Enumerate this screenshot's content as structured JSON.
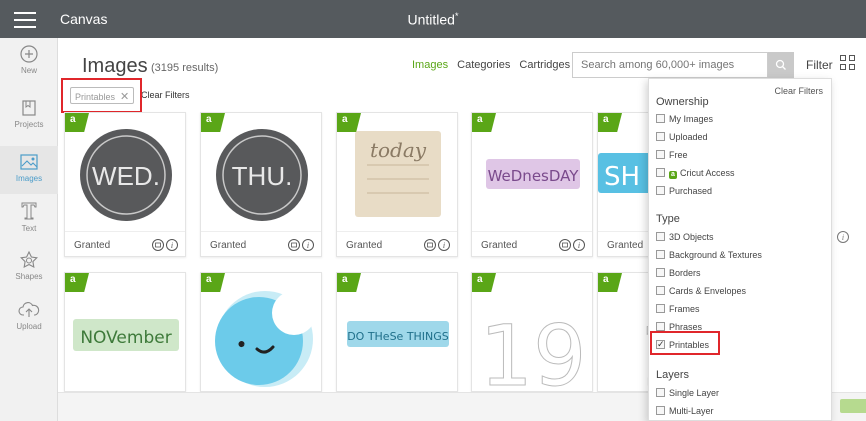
{
  "app": {
    "name": "Canvas",
    "document_title": "Untitled",
    "unsaved_marker": "*"
  },
  "sidebar": {
    "items": [
      {
        "label": "New",
        "icon": "plus-circle-icon"
      },
      {
        "label": "Projects",
        "icon": "projects-icon"
      },
      {
        "label": "Images",
        "icon": "images-icon",
        "active": true
      },
      {
        "label": "Text",
        "icon": "text-icon"
      },
      {
        "label": "Shapes",
        "icon": "shapes-icon"
      },
      {
        "label": "Upload",
        "icon": "upload-cloud-icon"
      }
    ]
  },
  "header": {
    "title": "Images",
    "results": "(3195 results)",
    "tabs": [
      "Images",
      "Categories",
      "Cartridges"
    ],
    "search_placeholder": "Search among 60,000+ images",
    "filter_label": "Filter"
  },
  "active_filter": {
    "chip_label": "Printables",
    "clear_label": "Clear Filters"
  },
  "tiles": [
    {
      "badge": "a",
      "status": "Granted",
      "art_text": "WED.",
      "style": "dark-circle"
    },
    {
      "badge": "a",
      "status": "Granted",
      "art_text": "THU.",
      "style": "dark-circle"
    },
    {
      "badge": "a",
      "status": "Granted",
      "art_text": "today",
      "style": "paper-note"
    },
    {
      "badge": "a",
      "status": "Granted",
      "art_text": "WeDnesDAY",
      "style": "pink-label"
    },
    {
      "badge": "a",
      "status": "Granted",
      "art_text": "SH",
      "style": "blue-label"
    },
    {
      "badge": "a",
      "art_text": "NOVember",
      "style": "green-label"
    },
    {
      "badge": "a",
      "art_text": "",
      "style": "moon-face"
    },
    {
      "badge": "a",
      "art_text": "DO THeSe THINGS",
      "style": "blue-banner"
    },
    {
      "badge": "a",
      "art_text": "19",
      "style": "outline-numbers"
    },
    {
      "badge": "a",
      "art_text": "1",
      "style": "outline-numbers"
    }
  ],
  "filter_panel": {
    "clear_label": "Clear Filters",
    "sections": [
      {
        "title": "Ownership",
        "options": [
          {
            "label": "My Images",
            "checked": false
          },
          {
            "label": "Uploaded",
            "checked": false
          },
          {
            "label": "Free",
            "checked": false
          },
          {
            "label": "Cricut Access",
            "checked": false,
            "icon": "cricut-access-icon"
          },
          {
            "label": "Purchased",
            "checked": false
          }
        ]
      },
      {
        "title": "Type",
        "options": [
          {
            "label": "3D Objects",
            "checked": false
          },
          {
            "label": "Background & Textures",
            "checked": false
          },
          {
            "label": "Borders",
            "checked": false
          },
          {
            "label": "Cards & Envelopes",
            "checked": false
          },
          {
            "label": "Frames",
            "checked": false
          },
          {
            "label": "Phrases",
            "checked": false
          },
          {
            "label": "Printables",
            "checked": true
          }
        ]
      },
      {
        "title": "Layers",
        "options": [
          {
            "label": "Single Layer",
            "checked": false
          },
          {
            "label": "Multi-Layer",
            "checked": false
          }
        ]
      }
    ]
  },
  "colors": {
    "topbar": "#555a5e",
    "accent_green": "#5aa617",
    "highlight_red": "#e0262b",
    "link_blue": "#4b9cc9"
  }
}
